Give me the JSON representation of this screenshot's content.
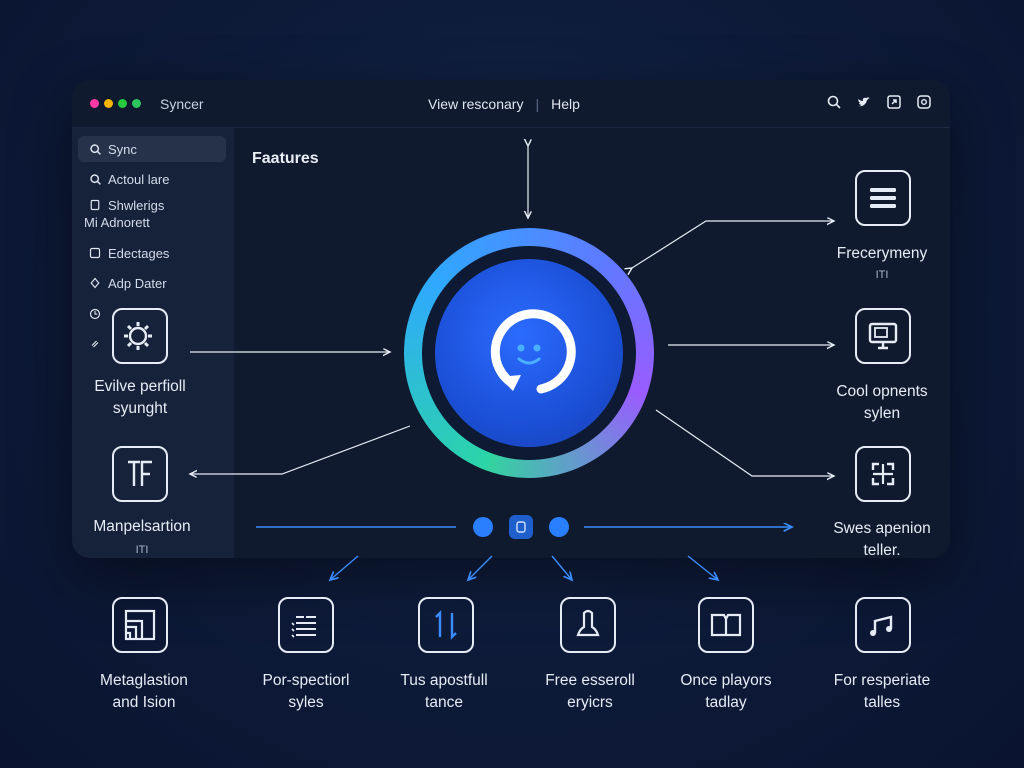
{
  "app": {
    "title": "Syncer",
    "menu": [
      "View resconary",
      "Help"
    ]
  },
  "colors": {
    "dot1": "#ff3aa6",
    "dot2": "#f7b500",
    "dot3": "#27c93f",
    "dot4": "#2ec55f",
    "accent": "#2a7fff"
  },
  "sidebar": {
    "items": [
      {
        "icon": "search-icon",
        "label": "Sync"
      },
      {
        "icon": "search-icon",
        "label": "Actoul lare"
      },
      {
        "icon": "document-icon",
        "label": "Shwlerigs"
      },
      {
        "icon": "",
        "label": "Mi Adnorett"
      },
      {
        "icon": "edit-icon",
        "label": "Edectages"
      },
      {
        "icon": "plugin-icon",
        "label": "Adp Dater"
      }
    ]
  },
  "main": {
    "section_title": "Faatures"
  },
  "left_features": [
    {
      "icon": "gear-icon",
      "label_line1": "Evilve perfioll",
      "label_line2": "syunght"
    },
    {
      "icon": "tf-icon",
      "label_line1": "Manpelsartion",
      "sublabel": "ITI"
    }
  ],
  "right_features": [
    {
      "icon": "list-icon",
      "label_line1": "Frecerymeny",
      "sublabel": "ITI"
    },
    {
      "icon": "monitor-icon",
      "label_line1": "Cool opnents",
      "label_line2": "sylen"
    },
    {
      "icon": "grid-icon",
      "label_line1": "Swes apenion",
      "label_line2": "teller."
    }
  ],
  "bottom_features": [
    {
      "icon": "layers-icon",
      "label_line1": "Metaglastion",
      "label_line2": "and Ision"
    },
    {
      "icon": "checklist-icon",
      "label_line1": "Por-spectiorl",
      "label_line2": "syles"
    },
    {
      "icon": "arrows-icon",
      "label_line1": "Tus apostfull",
      "label_line2": "tance"
    },
    {
      "icon": "person-icon",
      "label_line1": "Free esseroll",
      "label_line2": "eryicrs"
    },
    {
      "icon": "book-icon",
      "label_line1": "Once playors",
      "label_line2": "tadlay"
    },
    {
      "icon": "music-icon",
      "label_line1": "For resperiate",
      "label_line2": "talles"
    }
  ]
}
